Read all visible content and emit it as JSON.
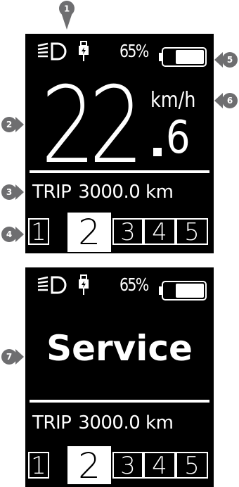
{
  "screen1": {
    "battery_pct": "65%",
    "speed_int": "22",
    "speed_dec": "6",
    "unit": "km/h",
    "trip_label": "TRIP",
    "trip_value": "3000.0 km",
    "levels": [
      "1",
      "2",
      "3",
      "4",
      "5"
    ],
    "selected_level": "2"
  },
  "screen2": {
    "battery_pct": "65%",
    "message": "Service",
    "trip_label": "TRIP",
    "trip_value": "3000.0 km",
    "levels": [
      "1",
      "2",
      "3",
      "4",
      "5"
    ],
    "selected_level": "2"
  },
  "markers": [
    "1",
    "2",
    "3",
    "4",
    "5",
    "6",
    "7"
  ],
  "icons": {
    "headlight": "headlight-icon",
    "usb": "usb-icon",
    "battery": "battery-icon"
  },
  "colors": {
    "screen_bg": "#000000",
    "foreground": "#ffffff",
    "marker": "#6e6e70"
  }
}
